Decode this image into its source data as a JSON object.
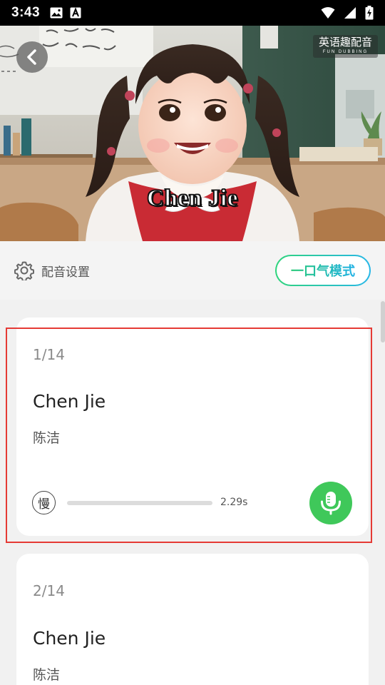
{
  "status_bar": {
    "time": "3:43",
    "icons": [
      "image-icon",
      "text-a-icon",
      "wifi-icon",
      "signal-icon",
      "battery-charging-icon"
    ]
  },
  "video": {
    "subtitle": "Chen Jie",
    "watermark_main": "英语趣配音",
    "watermark_sub": "FUN DUBBING",
    "back_icon": "chevron-left-icon"
  },
  "settings": {
    "icon": "gear-icon",
    "label": "配音设置",
    "mode_button": "一口气模式"
  },
  "sentences": [
    {
      "index": "1/14",
      "english": "Chen Jie",
      "chinese": "陈洁",
      "speed_label": "慢",
      "duration": "2.29s",
      "progress": 0,
      "mic_icon": "microphone-icon"
    },
    {
      "index": "2/14",
      "english": "Chen Jie",
      "chinese": "陈洁"
    }
  ],
  "colors": {
    "accent_green": "#3fc85a",
    "mode_gradient_start": "#2fd47c",
    "mode_gradient_end": "#27b7e8",
    "highlight_red": "#e53a35"
  }
}
